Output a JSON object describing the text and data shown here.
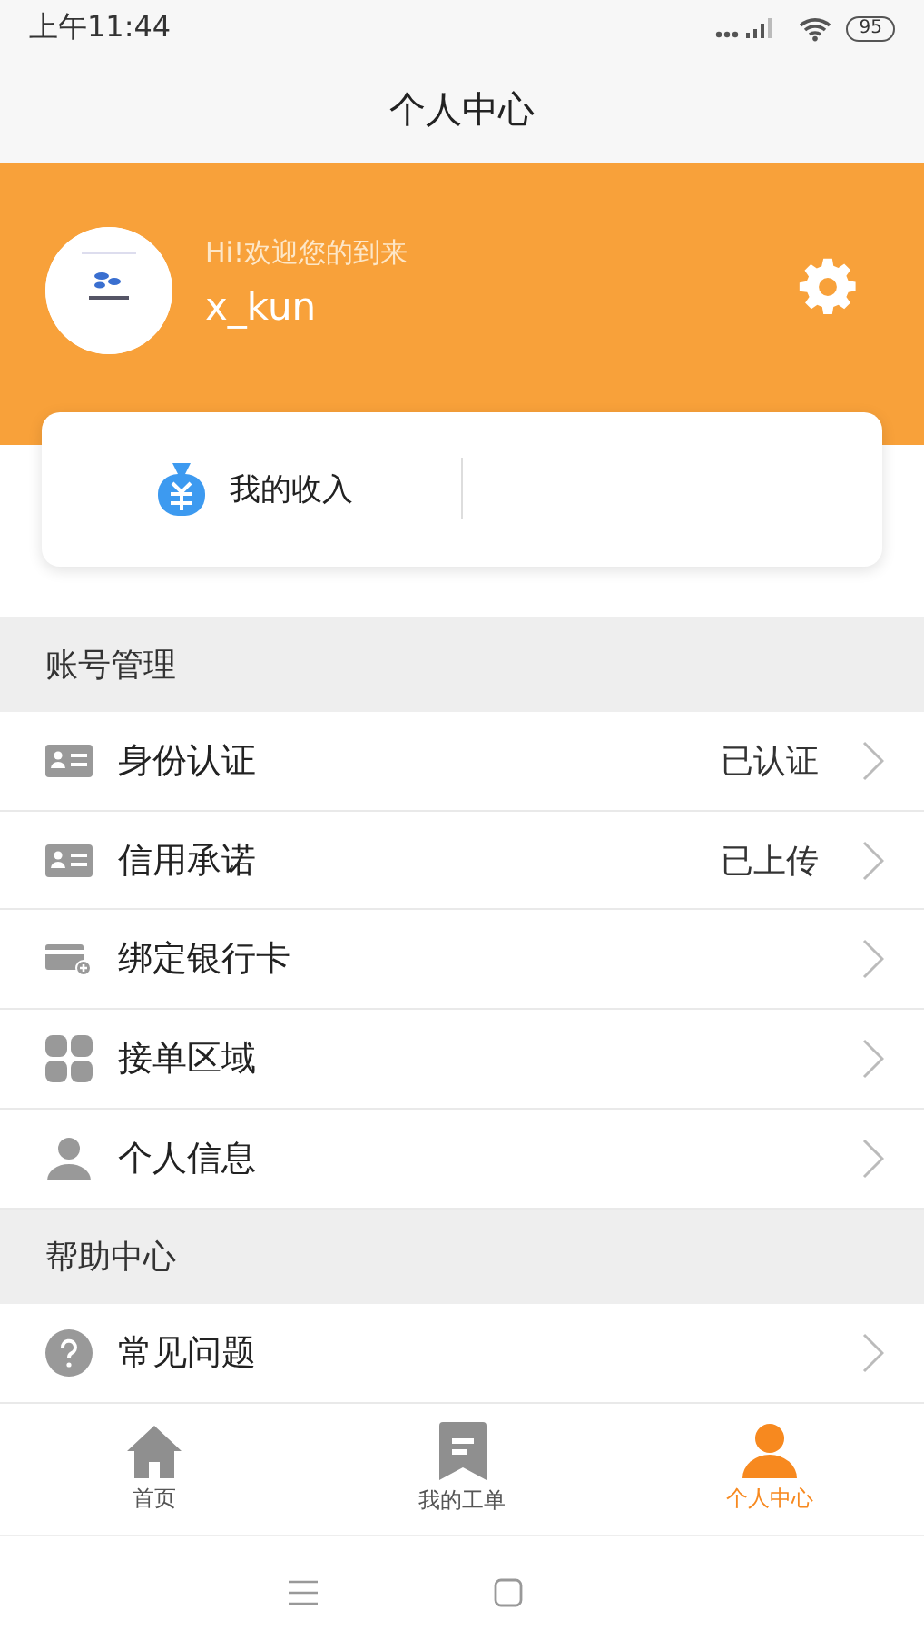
{
  "status_bar": {
    "time": "上午11:44",
    "battery": "95"
  },
  "title": "个人中心",
  "profile": {
    "greeting": "Hi!欢迎您的到来",
    "username": "x_kun"
  },
  "income": {
    "label": "我的收入"
  },
  "sections": [
    {
      "title": "账号管理",
      "items": [
        {
          "kind": "id-card",
          "label": "身份认证",
          "value": "已认证"
        },
        {
          "kind": "id-card",
          "label": "信用承诺",
          "value": "已上传"
        },
        {
          "kind": "bank-card",
          "label": "绑定银行卡"
        },
        {
          "kind": "grid",
          "label": "接单区域"
        },
        {
          "kind": "person",
          "label": "个人信息"
        }
      ]
    },
    {
      "title": "帮助中心",
      "items": [
        {
          "kind": "question",
          "label": "常见问题"
        }
      ]
    }
  ],
  "tabs": [
    {
      "kind": "home",
      "label": "首页",
      "selected": false
    },
    {
      "kind": "bookmark",
      "label": "我的工单",
      "selected": false
    },
    {
      "kind": "person",
      "label": "个人中心",
      "selected": true
    }
  ]
}
